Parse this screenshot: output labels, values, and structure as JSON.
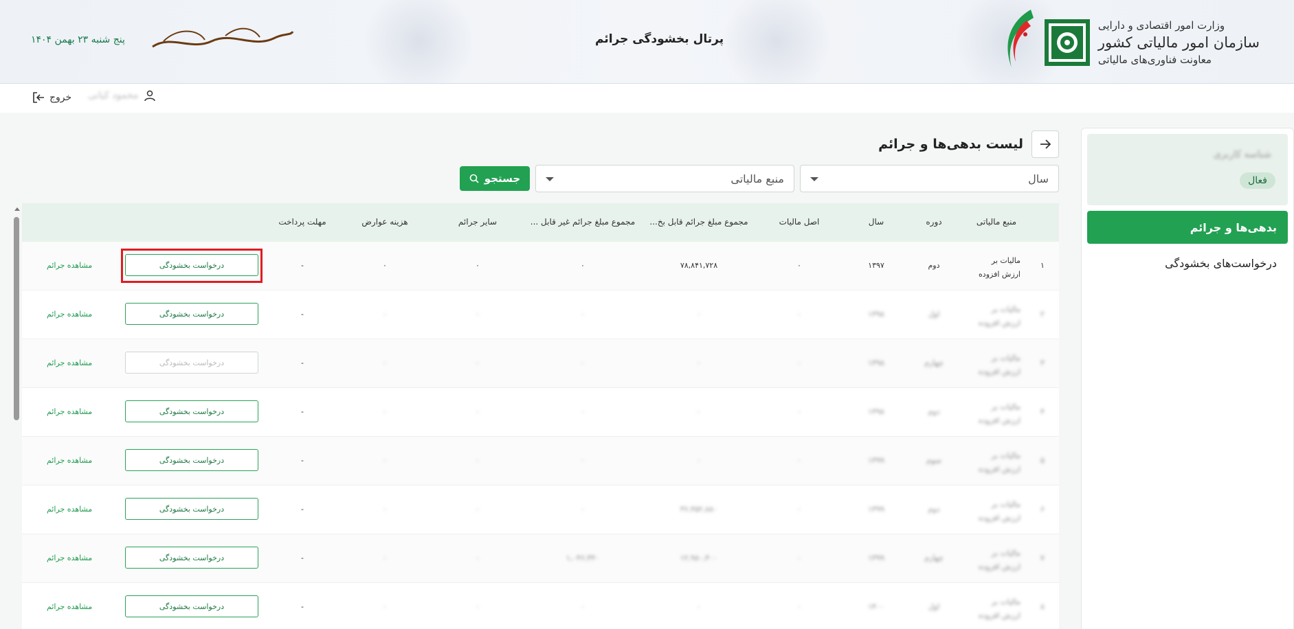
{
  "header": {
    "org_line1": "وزارت امور اقتصادی و دارایی",
    "org_line2": "سازمان امور مالیاتی کشور",
    "org_line3": "معاونت فناوری‌های مالیاتی",
    "portal_title": "پرتال بخشودگی جرائم",
    "date": "پنج شنبه ۲۳ بهمن ۱۴۰۴"
  },
  "topbar": {
    "user_name": "محمود کیانی",
    "logout_label": "خروج"
  },
  "sidebar": {
    "user_name": "شناسه کاربری",
    "status_badge": "فعال",
    "items": [
      {
        "label": "بدهی‌ها و جرائم",
        "active": true
      },
      {
        "label": "درخواست‌های بخشودگی",
        "active": false
      }
    ]
  },
  "page": {
    "title": "لیست بدهی‌ها و جرائم",
    "filter_year_placeholder": "سال",
    "filter_source_placeholder": "منبع مالیاتی",
    "search_label": "جستجو"
  },
  "table": {
    "headers": {
      "source": "منبع مالیاتی",
      "period": "دوره",
      "year": "سال",
      "principal": "اصل مالیات",
      "forgivable": "مجموع مبلغ جرائم قابل بخ...",
      "nonforgivable": "مجموع مبلغ جرائم غیر قابل ...",
      "other": "سایر جرائم",
      "fees": "هزینه عوارض",
      "deadline": "مهلت پرداخت"
    },
    "request_label": "درخواست بخشودگی",
    "view_label": "مشاهده جرائم",
    "rows": [
      {
        "num": "۱",
        "source": "مالیات بر ارزش افزوده",
        "period": "دوم",
        "year": "۱۳۹۷",
        "principal": "۰",
        "forgivable": "۷۸,۸۴۱,۷۲۸",
        "nonforgivable": "۰",
        "other": "۰",
        "fees": "۰",
        "deadline": "-",
        "blurred": false,
        "disabled": false
      },
      {
        "num": "۲",
        "source": "مالیات بر ارزش افزوده",
        "period": "اول",
        "year": "۱۳۹۸",
        "principal": "۰",
        "forgivable": "۰",
        "nonforgivable": "۰",
        "other": "۰",
        "fees": "۰",
        "deadline": "-",
        "blurred": true,
        "disabled": false
      },
      {
        "num": "۳",
        "source": "مالیات بر ارزش افزوده",
        "period": "چهارم",
        "year": "۱۳۹۸",
        "principal": "۰",
        "forgivable": "۰",
        "nonforgivable": "۰",
        "other": "۰",
        "fees": "۰",
        "deadline": "-",
        "blurred": true,
        "disabled": true
      },
      {
        "num": "۴",
        "source": "مالیات بر ارزش افزوده",
        "period": "دوم",
        "year": "۱۳۹۸",
        "principal": "۰",
        "forgivable": "۰",
        "nonforgivable": "۰",
        "other": "۰",
        "fees": "۰",
        "deadline": "-",
        "blurred": true,
        "disabled": false
      },
      {
        "num": "۵",
        "source": "مالیات بر ارزش افزوده",
        "period": "سوم",
        "year": "۱۳۹۹",
        "principal": "۰",
        "forgivable": "۰",
        "nonforgivable": "۰",
        "other": "۰",
        "fees": "۰",
        "deadline": "-",
        "blurred": true,
        "disabled": false
      },
      {
        "num": "۶",
        "source": "مالیات بر ارزش افزوده",
        "period": "دوم",
        "year": "۱۳۹۹",
        "principal": "۰",
        "forgivable": "۳۶,۴۵۲,۸۸۰",
        "nonforgivable": "۰",
        "other": "۰",
        "fees": "۰",
        "deadline": "-",
        "blurred": true,
        "disabled": false
      },
      {
        "num": "۷",
        "source": "مالیات بر ارزش افزوده",
        "period": "چهارم",
        "year": "۱۳۹۹",
        "principal": "۰",
        "forgivable": "۱۲,۹۸۰,۴۰۰",
        "nonforgivable": "۱,۰۴۶,۴۴۰",
        "other": "۰",
        "fees": "۰",
        "deadline": "-",
        "blurred": true,
        "disabled": false
      },
      {
        "num": "۸",
        "source": "مالیات بر ارزش افزوده",
        "period": "اول",
        "year": "۱۴۰۰",
        "principal": "۰",
        "forgivable": "۰",
        "nonforgivable": "۰",
        "other": "۰",
        "fees": "۰",
        "deadline": "-",
        "blurred": true,
        "disabled": false
      }
    ]
  }
}
